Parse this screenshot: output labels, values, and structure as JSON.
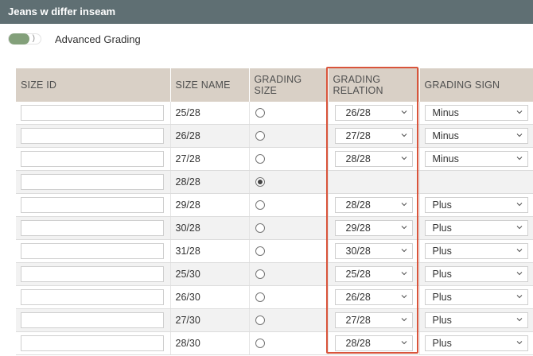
{
  "window": {
    "title": "Jeans w differ inseam"
  },
  "toggle": {
    "label": "Advanced Grading",
    "on": true,
    "accent": "#83a07a"
  },
  "table": {
    "headers": {
      "size_id": "SIZE ID",
      "size_name": "SIZE NAME",
      "grading_size": "GRADING SIZE",
      "grading_relation": "GRADING RELATION",
      "grading_sign": "GRADING SIGN"
    },
    "rows": [
      {
        "size_id": "",
        "size_name": "25/28",
        "grading_size": false,
        "relation": "26/28",
        "sign": "Minus"
      },
      {
        "size_id": "",
        "size_name": "26/28",
        "grading_size": false,
        "relation": "27/28",
        "sign": "Minus"
      },
      {
        "size_id": "",
        "size_name": "27/28",
        "grading_size": false,
        "relation": "28/28",
        "sign": "Minus"
      },
      {
        "size_id": "",
        "size_name": "28/28",
        "grading_size": true,
        "relation": null,
        "sign": null
      },
      {
        "size_id": "",
        "size_name": "29/28",
        "grading_size": false,
        "relation": "28/28",
        "sign": "Plus"
      },
      {
        "size_id": "",
        "size_name": "30/28",
        "grading_size": false,
        "relation": "29/28",
        "sign": "Plus"
      },
      {
        "size_id": "",
        "size_name": "31/28",
        "grading_size": false,
        "relation": "30/28",
        "sign": "Plus"
      },
      {
        "size_id": "",
        "size_name": "25/30",
        "grading_size": false,
        "relation": "25/28",
        "sign": "Plus"
      },
      {
        "size_id": "",
        "size_name": "26/30",
        "grading_size": false,
        "relation": "26/28",
        "sign": "Plus"
      },
      {
        "size_id": "",
        "size_name": "27/30",
        "grading_size": false,
        "relation": "27/28",
        "sign": "Plus"
      },
      {
        "size_id": "",
        "size_name": "28/30",
        "grading_size": false,
        "relation": "28/28",
        "sign": "Plus"
      }
    ]
  },
  "colors": {
    "titlebar": "#5f6f73",
    "header_bg": "#d9d0c6",
    "highlight_border": "#d9543b"
  }
}
